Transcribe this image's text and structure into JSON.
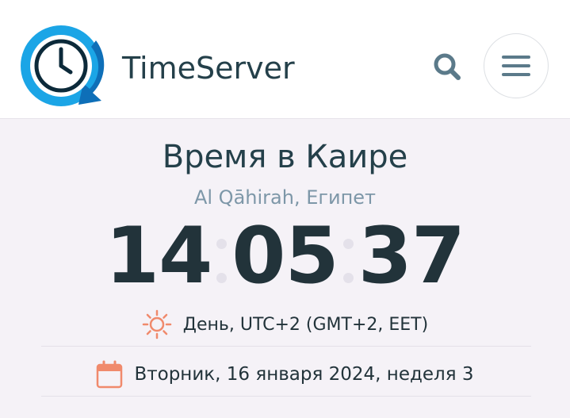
{
  "header": {
    "brand": "TimeServer",
    "colors": {
      "logo_blue": "#1b9ee0",
      "logo_dark": "#0d69b0",
      "icon_color": "#5b7a8a"
    }
  },
  "location": {
    "title": "Время в Каире",
    "subtitle": "Al Qāhirah, Египет"
  },
  "clock": {
    "hours": "14",
    "minutes": "05",
    "seconds": "37"
  },
  "day_info": {
    "text": "День, UTC+2 (GMT+2, EET)",
    "icon": "sun-icon",
    "icon_color": "#f08a6c"
  },
  "date_info": {
    "text": "Вторник, 16 января 2024, неделя 3",
    "icon": "calendar-icon",
    "icon_color": "#f08a6c"
  }
}
